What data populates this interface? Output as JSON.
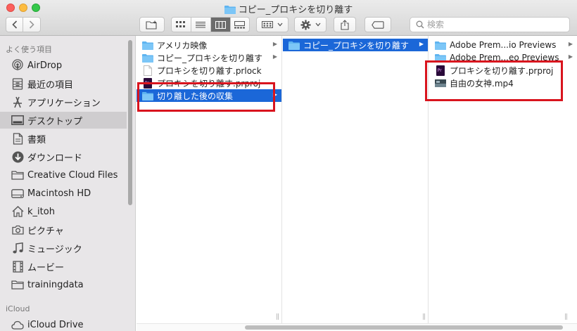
{
  "window": {
    "title": "コピー_プロキシを切り離す"
  },
  "toolbar": {
    "search_placeholder": "検索",
    "icons": [
      "chevron-left-icon",
      "chevron-right-icon",
      "new-folder-icon",
      "view-icons-icon",
      "view-list-icon",
      "view-columns-icon",
      "view-gallery-icon",
      "group-icon",
      "gear-icon",
      "share-icon",
      "tag-icon",
      "search-icon"
    ]
  },
  "sidebar": {
    "section_favorites": "よく使う項目",
    "section_icloud": "iCloud",
    "items": [
      {
        "label": "AirDrop",
        "icon": "airdrop-icon"
      },
      {
        "label": "最近の項目",
        "icon": "recents-icon"
      },
      {
        "label": "アプリケーション",
        "icon": "applications-icon"
      },
      {
        "label": "デスクトップ",
        "icon": "desktop-icon",
        "selected": true
      },
      {
        "label": "書類",
        "icon": "documents-icon"
      },
      {
        "label": "ダウンロード",
        "icon": "downloads-icon"
      },
      {
        "label": "Creative Cloud Files",
        "icon": "folder-icon"
      },
      {
        "label": "Macintosh HD",
        "icon": "harddisk-icon"
      },
      {
        "label": "k_itoh",
        "icon": "home-icon"
      },
      {
        "label": "ピクチャ",
        "icon": "camera-icon"
      },
      {
        "label": "ミュージック",
        "icon": "music-icon"
      },
      {
        "label": "ムービー",
        "icon": "film-icon"
      },
      {
        "label": "trainingdata",
        "icon": "folder-icon"
      }
    ],
    "icloud_items": [
      {
        "label": "iCloud Drive",
        "icon": "cloud-icon"
      }
    ]
  },
  "columns": [
    {
      "items": [
        {
          "label": "アメリカ映像",
          "type": "folder",
          "arrow": true
        },
        {
          "label": "コピー_プロキシを切り離す",
          "type": "folder",
          "arrow": true
        },
        {
          "label": "プロキシを切り離す.prlock",
          "type": "file"
        },
        {
          "label": "プロキシを切り離す.prproj",
          "type": "premiere"
        },
        {
          "label": "切り離した後の収集",
          "type": "folder",
          "arrow": true,
          "selected": true
        }
      ]
    },
    {
      "items": [
        {
          "label": "コピー_プロキシを切り離す",
          "type": "folder",
          "arrow": true,
          "selected": true
        }
      ]
    },
    {
      "items": [
        {
          "label": "Adobe Prem...io Previews",
          "type": "folder",
          "arrow": true
        },
        {
          "label": "Adobe Prem...eo Previews",
          "type": "folder",
          "arrow": true
        },
        {
          "label": "プロキシを切り離す.prproj",
          "type": "premiere"
        },
        {
          "label": "自由の女神.mp4",
          "type": "video"
        }
      ]
    }
  ],
  "colors": {
    "selection": "#1b67d8",
    "highlight_box": "#d9141e",
    "sidebar_bg": "#e8e6e8"
  }
}
